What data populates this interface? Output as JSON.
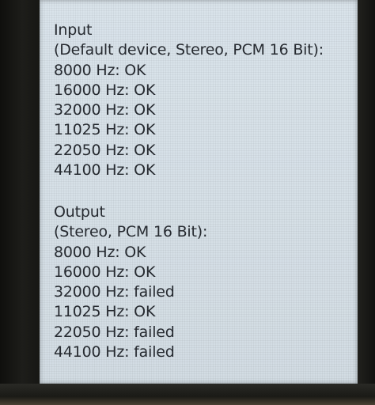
{
  "input": {
    "title": "Input",
    "subtitle": "(Default device, Stereo, PCM 16 Bit):",
    "results": [
      "8000 Hz: OK",
      "16000 Hz: OK",
      "32000 Hz: OK",
      "11025 Hz: OK",
      "22050 Hz: OK",
      "44100 Hz: OK"
    ]
  },
  "output": {
    "title": "Output",
    "subtitle": "(Stereo, PCM 16 Bit):",
    "results": [
      "8000 Hz: OK",
      "16000 Hz: OK",
      "32000 Hz: failed",
      "11025 Hz: OK",
      "22050 Hz: failed",
      "44100 Hz: failed"
    ]
  },
  "colors": {
    "screen_background": "#d8e2e9",
    "text": "#262a30",
    "device_frame": "#1a1a17"
  }
}
